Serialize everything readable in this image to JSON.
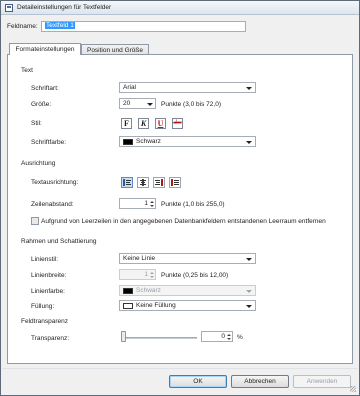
{
  "window": {
    "title": "Detaileinstellungen für Textfelder"
  },
  "fieldname": {
    "label": "Feldname:",
    "value": "Textfeld 1"
  },
  "tabs": [
    {
      "label": "Formateinstellungen",
      "active": true
    },
    {
      "label": "Position und Größe",
      "active": false
    }
  ],
  "text_section": {
    "heading": "Text",
    "font": {
      "label": "Schriftart:",
      "value": "Arial"
    },
    "size": {
      "label": "Größe:",
      "value": "20",
      "hint": "Punkte (3,0 bis 72,0)"
    },
    "style": {
      "label": "Stil:",
      "buttons": [
        "F",
        "K",
        "U",
        "abc"
      ]
    },
    "color": {
      "label": "Schriftfarbe:",
      "value": "Schwarz",
      "swatch": "#000000"
    }
  },
  "alignment_section": {
    "heading": "Ausrichtung",
    "text_align": {
      "label": "Textausrichtung:",
      "icons": [
        "align-left-icon",
        "align-center-icon",
        "align-right-icon",
        "align-justify-icon"
      ]
    },
    "line_spacing": {
      "label": "Zeilenabstand:",
      "value": "1",
      "hint": "Punkte (1,0 bis 255,0)"
    },
    "remove_space": {
      "label": "Aufgrund von Leerzeilen in den angegebenen Datenbankfeldern entstandenen Leerraum entfernen",
      "checked": false
    }
  },
  "border_section": {
    "heading": "Rahmen und Schattierung",
    "line_style": {
      "label": "Linienstil:",
      "value": "Keine Linie"
    },
    "line_width": {
      "label": "Linienbreite:",
      "value": "1",
      "hint": "Punkte (0,25 bis 12,00)"
    },
    "line_color": {
      "label": "Linienfarbe:",
      "value": "Schwarz",
      "swatch": "#000000"
    },
    "fill": {
      "label": "Füllung:",
      "value": "Keine Füllung",
      "swatch": "#ffffff"
    }
  },
  "transparency_section": {
    "heading": "Feldtransparenz",
    "transparency": {
      "label": "Transparenz:",
      "value": "0",
      "unit": "%",
      "level": 0
    }
  },
  "buttons": {
    "ok": "OK",
    "cancel": "Abbrechen",
    "apply": "Anwenden"
  },
  "colors": {
    "accent": "#3399ff",
    "border": "#8e9aa8"
  }
}
